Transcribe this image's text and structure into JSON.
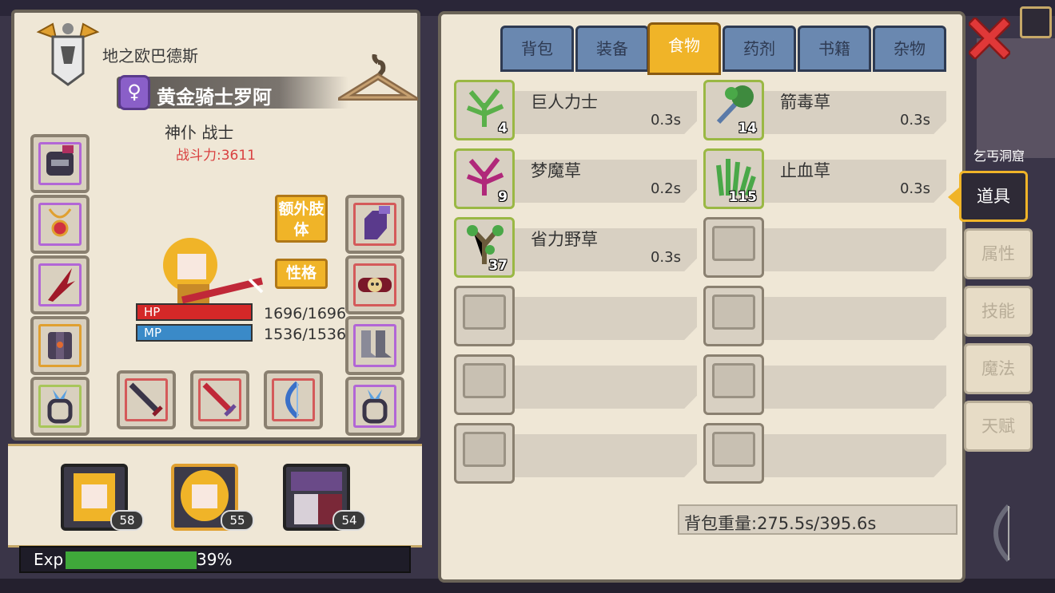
{
  "character": {
    "title": "地之欧巴德斯",
    "name": "黄金骑士罗阿",
    "gender_symbol": "♀",
    "class": "神仆 战士",
    "power": "战斗力:3611",
    "hp_label": "HP",
    "mp_label": "MP",
    "hp_value": "1696/1696",
    "mp_value": "1536/1536",
    "hp_fraction": 1.0,
    "mp_fraction": 1.0,
    "extra_limbs_label": "额外肢体",
    "personality_label": "性格"
  },
  "party": [
    {
      "level": "58"
    },
    {
      "level": "55"
    },
    {
      "level": "54"
    }
  ],
  "exp": {
    "label": "Exp",
    "percent_text": "39%",
    "fraction": 0.39
  },
  "tabs": [
    {
      "label": "背包",
      "active": false
    },
    {
      "label": "装备",
      "active": false
    },
    {
      "label": "食物",
      "active": true
    },
    {
      "label": "药剂",
      "active": false
    },
    {
      "label": "书籍",
      "active": false
    },
    {
      "label": "杂物",
      "active": false
    }
  ],
  "items": [
    {
      "name": "巨人力士",
      "qty": "4",
      "time": "0.3s",
      "color": "#5ab04a"
    },
    {
      "name": "箭毒草",
      "qty": "14",
      "time": "0.3s",
      "color": "#3e8a3e"
    },
    {
      "name": "梦魔草",
      "qty": "9",
      "time": "0.2s",
      "color": "#b0287a"
    },
    {
      "name": "止血草",
      "qty": "115",
      "time": "0.3s",
      "color": "#4aa848"
    },
    {
      "name": "省力野草",
      "qty": "37",
      "time": "0.3s",
      "color": "#6a8a3a"
    }
  ],
  "weight": "背包重量:275.5s/395.6s",
  "side_tabs": [
    {
      "label": "道具",
      "active": true
    },
    {
      "label": "属性",
      "active": false
    },
    {
      "label": "技能",
      "active": false
    },
    {
      "label": "魔法",
      "active": false
    },
    {
      "label": "天赋",
      "active": false
    }
  ],
  "map_label": "乞丐洞窟"
}
